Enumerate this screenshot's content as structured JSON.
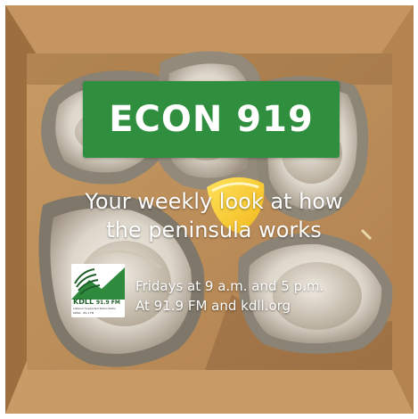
{
  "poster": {
    "title": "ECON 919",
    "tagline_line1": "Your weekly look at how",
    "tagline_line2": "the peninsula works",
    "schedule_line1": "Fridays at 9 a.m. and 5 p.m.",
    "schedule_line2": "At 91.9 FM and kdll.org"
  },
  "logo": {
    "station": "KDLL",
    "frequency": "91.9 FM",
    "slogan": "Listener Supported Public Radio",
    "footer": "KDNA · 89.1 FM"
  },
  "colors": {
    "title_background": "#2f8f3f",
    "box_cardboard": "#b88a55",
    "logo_green": "#2e8b3e"
  }
}
